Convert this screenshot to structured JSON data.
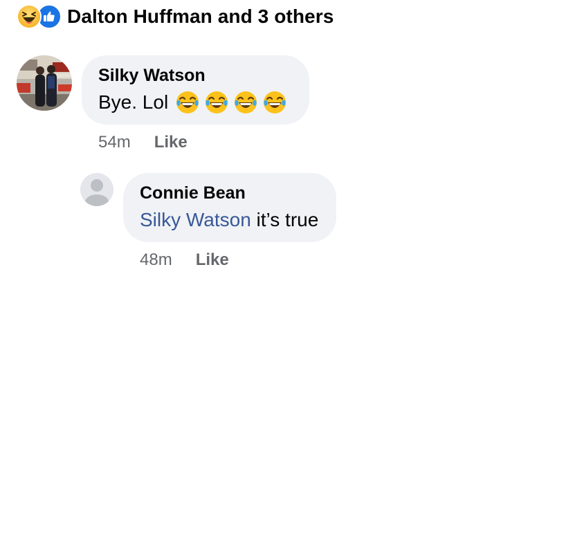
{
  "reactions": {
    "icons": [
      "haha-icon",
      "like-icon"
    ],
    "text": "Dalton Huffman and 3 others"
  },
  "comments": [
    {
      "author": "Silky Watson",
      "text": "Bye. Lol",
      "emojis": [
        "tears-of-joy-emoji",
        "tears-of-joy-emoji",
        "tears-of-joy-emoji",
        "tears-of-joy-emoji"
      ],
      "time": "54m",
      "like_label": "Like"
    },
    {
      "author": "Connie Bean",
      "mention": "Silky Watson",
      "text": " it’s true",
      "time": "48m",
      "like_label": "Like"
    }
  ],
  "colors": {
    "bubble": "#f0f2f5",
    "mention": "#385898",
    "meta_text": "#65676b",
    "like_blue": "#1b74e4"
  }
}
